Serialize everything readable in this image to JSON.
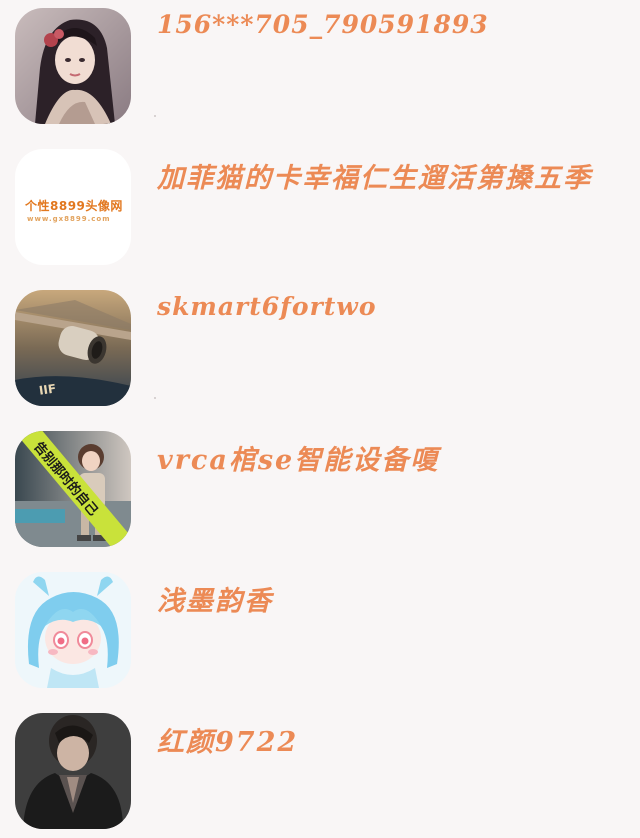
{
  "contacts": [
    {
      "name": "156***705_790591893"
    },
    {
      "name": "加菲猫的卡幸福仁生遛活第搡五季",
      "avatar_text": "个性8899头像网",
      "avatar_subtext": "www.gx8899.com"
    },
    {
      "name": "skmart6fortwo"
    },
    {
      "name": "vrca棺se智能设备嗄",
      "avatar_text": "告别那时的自己"
    },
    {
      "name": "浅墨韵香"
    },
    {
      "name": "红颜9722"
    }
  ],
  "colors": {
    "background": "#f9f6f6",
    "name_text": "#ec8a55"
  }
}
